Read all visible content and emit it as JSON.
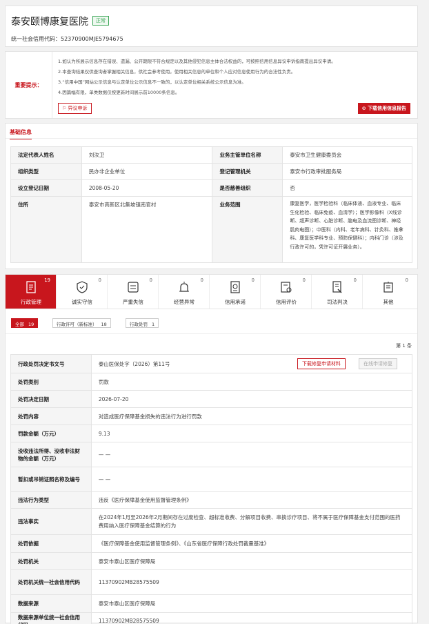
{
  "header": {
    "name": "泰安颐博康复医院",
    "status": "正常",
    "credit_code": "统一社会信用代码：52370900MJE5794675"
  },
  "notice": {
    "label": "重要提示：",
    "lines": [
      "1.如认为所展示信息存在错误、遗漏、公开期限不符合规定以及其他侵犯信息主体合法权益的，可按照信用信息异议申诉指南提出异议申请。",
      "2.本查询结果仅供查询者掌握相关信息，供社会参考使用。使用相关信息的单位和个人应对信息使用行为的合法性负责。",
      "3.“信用中国”网站公示信息与认定单位公示信息不一致的，以认定单位相关系统公示信息为准。",
      "4.因篇幅有限，单类数据仅按更新时间展示前10000条信息。"
    ],
    "objection_btn": "异议申诉",
    "download_btn": "下载信用信息报告"
  },
  "basic": {
    "title": "基础信息",
    "rows": [
      {
        "k1": "法定代表人姓名",
        "v1": "刘汝卫",
        "k2": "业务主管单位名称",
        "v2": "泰安市卫生健康委员会"
      },
      {
        "k1": "组织类型",
        "v1": "民办非企业单位",
        "k2": "登记管理机关",
        "v2": "泰安市行政审批服务局"
      },
      {
        "k1": "设立登记日期",
        "v1": "2008-05-20",
        "k2": "是否慈善组织",
        "v2": "否"
      },
      {
        "k1": "住所",
        "v1": "泰安市高新区北集坡镇南官村",
        "k2": "业务范围",
        "v2": "康复医学，医学检验科（临床体液、血液专业、临床生化检验、临床免疫、血清学）；医学影像科（X线诊断、超声诊断、心脏诊断、脑电及血流图诊断、神经肌肉电图）；中医科（内科、老年病科、针灸科、推拿科、康复医学科专业、预防保健科）；内科门诊（涉及行政许可的，凭许可证开展业务）。"
      }
    ]
  },
  "tabs": [
    {
      "label": "行政管理",
      "count": "19",
      "icon": "admin-doc-icon"
    },
    {
      "label": "诚实守信",
      "count": "0",
      "icon": "honesty-shield-icon"
    },
    {
      "label": "严重失信",
      "count": "0",
      "icon": "serious-dishonest-icon"
    },
    {
      "label": "经营异常",
      "count": "0",
      "icon": "abnormal-alarm-icon"
    },
    {
      "label": "信用承诺",
      "count": "0",
      "icon": "credit-promise-icon"
    },
    {
      "label": "信用评价",
      "count": "0",
      "icon": "credit-evaluation-icon"
    },
    {
      "label": "司法判决",
      "count": "0",
      "icon": "judicial-doc-icon"
    },
    {
      "label": "其他",
      "count": "0",
      "icon": "other-building-icon"
    }
  ],
  "filters": [
    {
      "label": "全部",
      "count": "19"
    },
    {
      "label": "行政许可（新标准）",
      "count": "18"
    },
    {
      "label": "行政处罚",
      "count": "1"
    }
  ],
  "record": {
    "count_text": "第 1 条",
    "download_btn": "下载修复申请材料",
    "online_btn": "在线申请修复",
    "rows": [
      {
        "k": "行政处罚决定书文号",
        "v": "泰山医保处字（2026）第11号"
      },
      {
        "k": "处罚类别",
        "v": "罚款"
      },
      {
        "k": "处罚决定日期",
        "v": "2026-07-20"
      },
      {
        "k": "处罚内容",
        "v": "对造成医疗保障基金损失的违法行为进行罚款"
      },
      {
        "k": "罚款金额（万元）",
        "v": "9.13"
      },
      {
        "k": "没收违法所得、没收非法财物的金额（万元）",
        "v": "— —"
      },
      {
        "k": "暂扣或吊销证照名称及编号",
        "v": "— —"
      },
      {
        "k": "违法行为类型",
        "v": "违反《医疗保障基金使用监督管理条例》"
      },
      {
        "k": "违法事实",
        "v": "在2024年1月至2026年2月期间存在过度检查、超标准收费、分解项目收费、串换诊疗项目、将不属于医疗保障基金支付范围的医药费用纳入医疗保障基金结算的行为"
      },
      {
        "k": "处罚依据",
        "v": "《医疗保障基金使用监督管理条例》、《山东省医疗保障行政处罚裁量基准》"
      },
      {
        "k": "处罚机关",
        "v": "泰安市泰山区医疗保障局"
      },
      {
        "k": "处罚机关统一社会信用代码",
        "v": "11370902MB28575509"
      },
      {
        "k": "数据来源",
        "v": "泰安市泰山区医疗保障局"
      },
      {
        "k": "数据来源单位统一社会信用代码",
        "v": "11370902MB28575509"
      }
    ]
  }
}
